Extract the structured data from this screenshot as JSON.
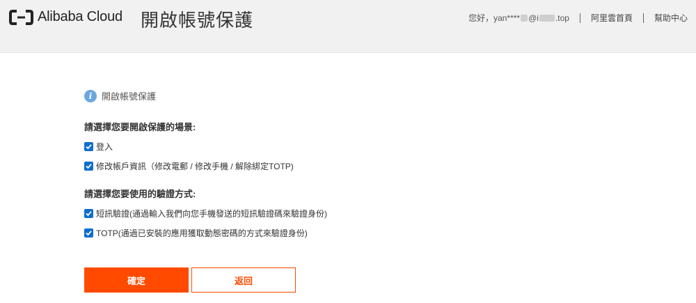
{
  "header": {
    "brand": "Alibaba Cloud",
    "title": "開啟帳號保護",
    "greeting_prefix": "您好，yan****",
    "greeting_mid": "@i",
    "greeting_suffix": ".top",
    "links": [
      "阿里雲首頁",
      "幫助中心"
    ]
  },
  "notice": {
    "icon": "info-icon",
    "text": "開啟帳號保護"
  },
  "scenario": {
    "title": "請選擇您要開啟保護的場景:",
    "options": [
      {
        "label": "登入",
        "checked": true
      },
      {
        "label": "修改帳戶資訊（修改電郵 / 修改手機 / 解除綁定TOTP)",
        "checked": true
      }
    ]
  },
  "method": {
    "title": "請選擇您要使用的驗證方式:",
    "options": [
      {
        "label": "短訊驗證(通過輸入我們向您手機發送的短訊驗證碼來驗證身份)",
        "checked": true
      },
      {
        "label": "TOTP(通過已安裝的應用獲取動態密碼的方式來驗證身份)",
        "checked": true
      }
    ]
  },
  "buttons": {
    "confirm": "確定",
    "back": "返回"
  },
  "colors": {
    "accent": "#ff4a00",
    "checkbox": "#0f6ecd",
    "info": "#6aa7e0",
    "header_bg": "#f1f1f1"
  }
}
